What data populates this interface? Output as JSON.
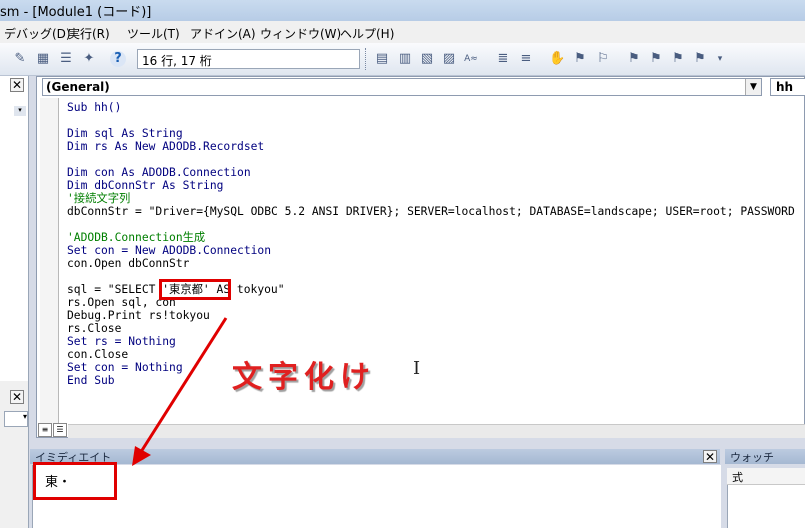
{
  "window": {
    "title": "sm - [Module1 (コード)]"
  },
  "menu": [
    "デバッグ(D)",
    "実行(R)",
    "ツール(T)",
    "アドイン(A)",
    "ウィンドウ(W)",
    "ヘルプ(H)"
  ],
  "toolbar": {
    "position_readout": "16 行, 17 桁",
    "icons_left": [
      "design-mode-icon",
      "project-explorer-icon",
      "properties-icon",
      "object-browser-icon",
      "toolbox-icon",
      "help-icon"
    ],
    "icons_right": [
      "indent-icon",
      "outdent-icon",
      "list-properties-icon",
      "list-constants-icon",
      "quick-info-icon",
      "parameter-info-icon",
      "complete-word-icon",
      "comment-block-icon",
      "uncomment-block-icon",
      "toggle-breakpoint-icon",
      "toggle-bookmark-icon",
      "next-bookmark-icon",
      "previous-bookmark-icon",
      "clear-bookmarks-icon"
    ]
  },
  "code_window": {
    "object_combo": "(General)",
    "procedure_combo": "hh",
    "lines": [
      {
        "segs": [
          {
            "t": "Sub hh()",
            "c": "kw"
          }
        ]
      },
      {
        "segs": []
      },
      {
        "segs": [
          {
            "t": "Dim sql As String",
            "c": "kw"
          }
        ]
      },
      {
        "segs": [
          {
            "t": "Dim rs As New ADODB.Recordset",
            "c": "kw"
          }
        ]
      },
      {
        "segs": []
      },
      {
        "segs": [
          {
            "t": "Dim con As ADODB.Connection",
            "c": "kw"
          }
        ]
      },
      {
        "segs": [
          {
            "t": "Dim dbConnStr As String",
            "c": "kw"
          }
        ]
      },
      {
        "segs": [
          {
            "t": "'接続文字列",
            "c": "cm"
          }
        ]
      },
      {
        "segs": [
          {
            "t": "dbConnStr = \"Driver={MySQL ODBC 5.2 ANSI DRIVER}; SERVER=localhost; DATABASE=landscape; USER=root; PASSWORD",
            "c": "tx"
          }
        ]
      },
      {
        "segs": []
      },
      {
        "segs": [
          {
            "t": "'ADODB.Connection生成",
            "c": "cm"
          }
        ]
      },
      {
        "segs": [
          {
            "t": "Set con = New ADODB.Connection",
            "c": "kw"
          }
        ]
      },
      {
        "segs": [
          {
            "t": "con.Open dbConnStr",
            "c": "tx"
          }
        ]
      },
      {
        "segs": []
      },
      {
        "segs": [
          {
            "t": "sql = \"SELECT '東京都' AS tokyou\"",
            "c": "tx"
          }
        ]
      },
      {
        "segs": [
          {
            "t": "rs.Open sql, con",
            "c": "tx"
          }
        ]
      },
      {
        "segs": [
          {
            "t": "Debug.Print rs!tokyou",
            "c": "tx"
          }
        ]
      },
      {
        "segs": [
          {
            "t": "rs.Close",
            "c": "tx"
          }
        ]
      },
      {
        "segs": [
          {
            "t": "Set rs = Nothing",
            "c": "kw"
          }
        ]
      },
      {
        "segs": [
          {
            "t": "con.Close",
            "c": "tx"
          }
        ]
      },
      {
        "segs": [
          {
            "t": "Set con = Nothing",
            "c": "kw"
          }
        ]
      },
      {
        "segs": [
          {
            "t": "End Sub",
            "c": "kw"
          }
        ]
      }
    ]
  },
  "immediate_window": {
    "title": "イミディエイト",
    "output": "東・"
  },
  "watch_window": {
    "title": "ウォッチ",
    "column_header": "式"
  },
  "annotation": {
    "label": "文字化け"
  },
  "colors": {
    "keyword": "#00007f",
    "comment": "#007f00",
    "annotation_red": "#e00000"
  }
}
